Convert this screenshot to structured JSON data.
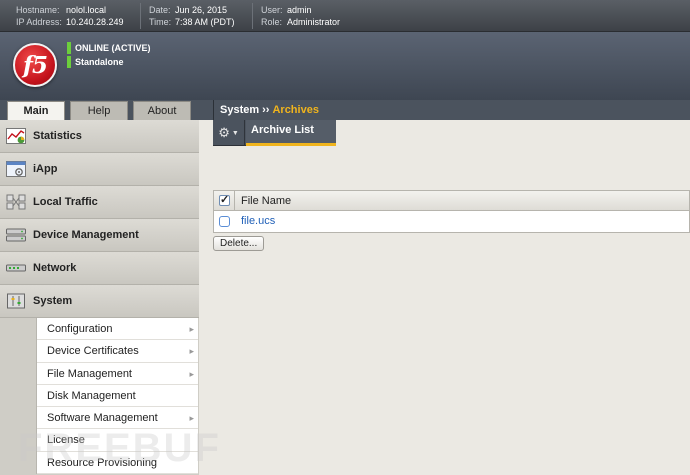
{
  "infobar": {
    "hostname_label": "Hostname:",
    "hostname": "nolol.local",
    "ip_label": "IP Address:",
    "ip": "10.240.28.249",
    "date_label": "Date:",
    "date": "Jun 26, 2015",
    "time_label": "Time:",
    "time": "7:38 AM (PDT)",
    "user_label": "User:",
    "user": "admin",
    "role_label": "Role:",
    "role": "Administrator"
  },
  "banner": {
    "logo_text": "f5",
    "status": "ONLINE (ACTIVE)",
    "mode": "Standalone",
    "status_color": "#6ccf3c"
  },
  "tabs": [
    {
      "label": "Main",
      "active": true
    },
    {
      "label": "Help",
      "active": false
    },
    {
      "label": "About",
      "active": false
    }
  ],
  "breadcrumb": {
    "parent": "System",
    "separator": "››",
    "current": "Archives",
    "current_color": "#f0b41d"
  },
  "nav": {
    "items": [
      {
        "label": "Statistics",
        "icon": "statistics-chart-icon"
      },
      {
        "label": "iApp",
        "icon": "iapp-icon"
      },
      {
        "label": "Local Traffic",
        "icon": "local-traffic-icon"
      },
      {
        "label": "Device Management",
        "icon": "device-management-icon"
      },
      {
        "label": "Network",
        "icon": "network-icon"
      },
      {
        "label": "System",
        "icon": "system-icon"
      }
    ],
    "system_submenu": [
      {
        "label": "Configuration",
        "has_submenu": true
      },
      {
        "label": "Device Certificates",
        "has_submenu": true
      },
      {
        "label": "File Management",
        "has_submenu": true
      },
      {
        "label": "Disk Management",
        "has_submenu": false
      },
      {
        "label": "Software Management",
        "has_submenu": true
      },
      {
        "label": "License",
        "has_submenu": false
      },
      {
        "label": "Resource Provisioning",
        "has_submenu": false
      }
    ]
  },
  "toolbar": {
    "gear_icon": "gear-icon",
    "subtab": "Archive List"
  },
  "archive_table": {
    "column": "File Name",
    "rows": [
      {
        "name": "file.ucs",
        "checked": false
      }
    ]
  },
  "actions": {
    "delete_label": "Delete..."
  },
  "watermark": "FREEBUF"
}
